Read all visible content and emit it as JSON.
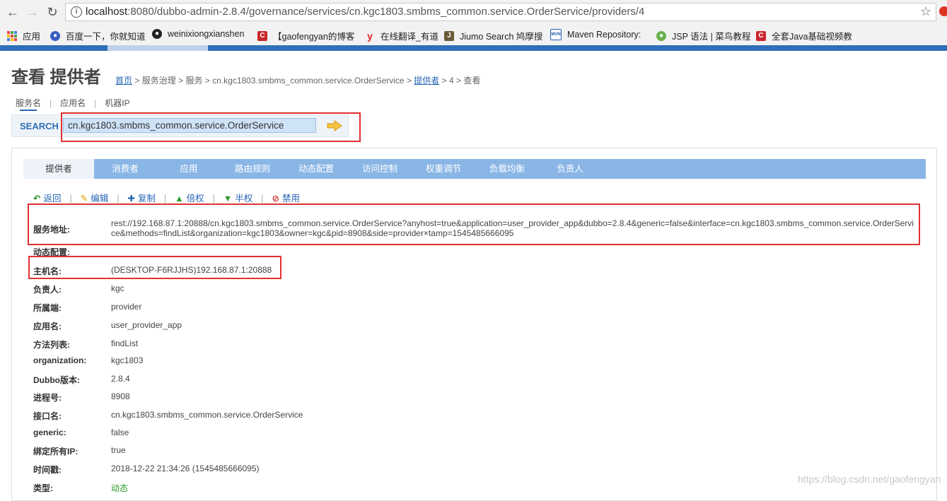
{
  "browser": {
    "url_host": "localhost",
    "url_path": ":8080/dubbo-admin-2.8.4/governance/services/cn.kgc1803.smbms_common.service.OrderService/providers/4",
    "bookmarks": [
      {
        "label": "应用",
        "icon": "apps-icon"
      },
      {
        "label": "百度一下，你就知道",
        "icon": "baidu-icon"
      },
      {
        "label": "weinixiongxianshen",
        "icon": "github-icon"
      },
      {
        "label": "【gaofengyan的博客",
        "icon": "csdn-icon"
      },
      {
        "label": "在线翻译_有道",
        "icon": "youdao-icon"
      },
      {
        "label": "Jiumo Search 鸠摩搜",
        "icon": "jiumo-icon"
      },
      {
        "label": "Maven Repository:",
        "icon": "maven-icon"
      },
      {
        "label": "JSP 语法 | 菜鸟教程",
        "icon": "runoob-icon"
      },
      {
        "label": "全套Java基础视频教",
        "icon": "csdn-icon"
      }
    ]
  },
  "page": {
    "title": "查看 提供者",
    "breadcrumb": {
      "home": "首页",
      "governance": "服务治理",
      "services": "服务",
      "service_name": "cn.kgc1803.smbms_common.service.OrderService",
      "providers": "提供者",
      "id": "4",
      "view": "查看",
      "sep": ">"
    }
  },
  "search": {
    "tabs": [
      "服务名",
      "应用名",
      "机器IP"
    ],
    "label": "SEARCH",
    "value": "cn.kgc1803.smbms_common.service.OrderService"
  },
  "tabs": [
    "提供者",
    "消费者",
    "应用",
    "路由规则",
    "动态配置",
    "访问控制",
    "权重调节",
    "负载均衡",
    "负责人"
  ],
  "actions": [
    {
      "label": "返回",
      "icon": "back-icon",
      "color": "#2a8a2a"
    },
    {
      "label": "编辑",
      "icon": "edit-icon",
      "color": "#e6a100"
    },
    {
      "label": "复制",
      "icon": "copy-icon",
      "color": "#2766b5"
    },
    {
      "label": "倍权",
      "icon": "double-weight-icon",
      "color": "#2a9a2a"
    },
    {
      "label": "半权",
      "icon": "half-weight-icon",
      "color": "#2a9a2a"
    },
    {
      "label": "禁用",
      "icon": "disable-icon",
      "color": "#d03030"
    }
  ],
  "details": {
    "address": {
      "label": "服务地址:",
      "value": "rest://192.168.87.1:20888/cn.kgc1803.smbms_common.service.OrderService?anyhost=true&application=user_provider_app&dubbo=2.8.4&generic=false&interface=cn.kgc1803.smbms_common.service.OrderService&methods=findList&organization=kgc1803&owner=kgc&pid=8908&side=provider×tamp=1545485666095"
    },
    "dynamic_config": {
      "label": "动态配置:",
      "value": ""
    },
    "host": {
      "label": "主机名:",
      "value": "(DESKTOP-F6RJJHS)192.168.87.1:20888"
    },
    "owner": {
      "label": "负责人:",
      "value": "kgc"
    },
    "side": {
      "label": "所属端:",
      "value": "provider"
    },
    "application": {
      "label": "应用名:",
      "value": "user_provider_app"
    },
    "methods": {
      "label": "方法列表:",
      "value": "findList"
    },
    "organization": {
      "label": "organization:",
      "value": "kgc1803"
    },
    "dubbo": {
      "label": "Dubbo版本:",
      "value": "2.8.4"
    },
    "pid": {
      "label": "进程号:",
      "value": "8908"
    },
    "interface": {
      "label": "接口名:",
      "value": "cn.kgc1803.smbms_common.service.OrderService"
    },
    "generic": {
      "label": "generic:",
      "value": "false"
    },
    "anyhost": {
      "label": "绑定所有IP:",
      "value": "true"
    },
    "timestamp": {
      "label": "时间戳:",
      "value": "2018-12-22 21:34:26 (1545485666095)"
    },
    "type": {
      "label": "类型:",
      "value": "动态"
    }
  },
  "watermark": "https://blog.csdn.net/gaofengyan",
  "colors": {
    "accent": "#2f6fb7",
    "tab_bar": "#8ab6e6",
    "highlight_box": "#e03030"
  }
}
